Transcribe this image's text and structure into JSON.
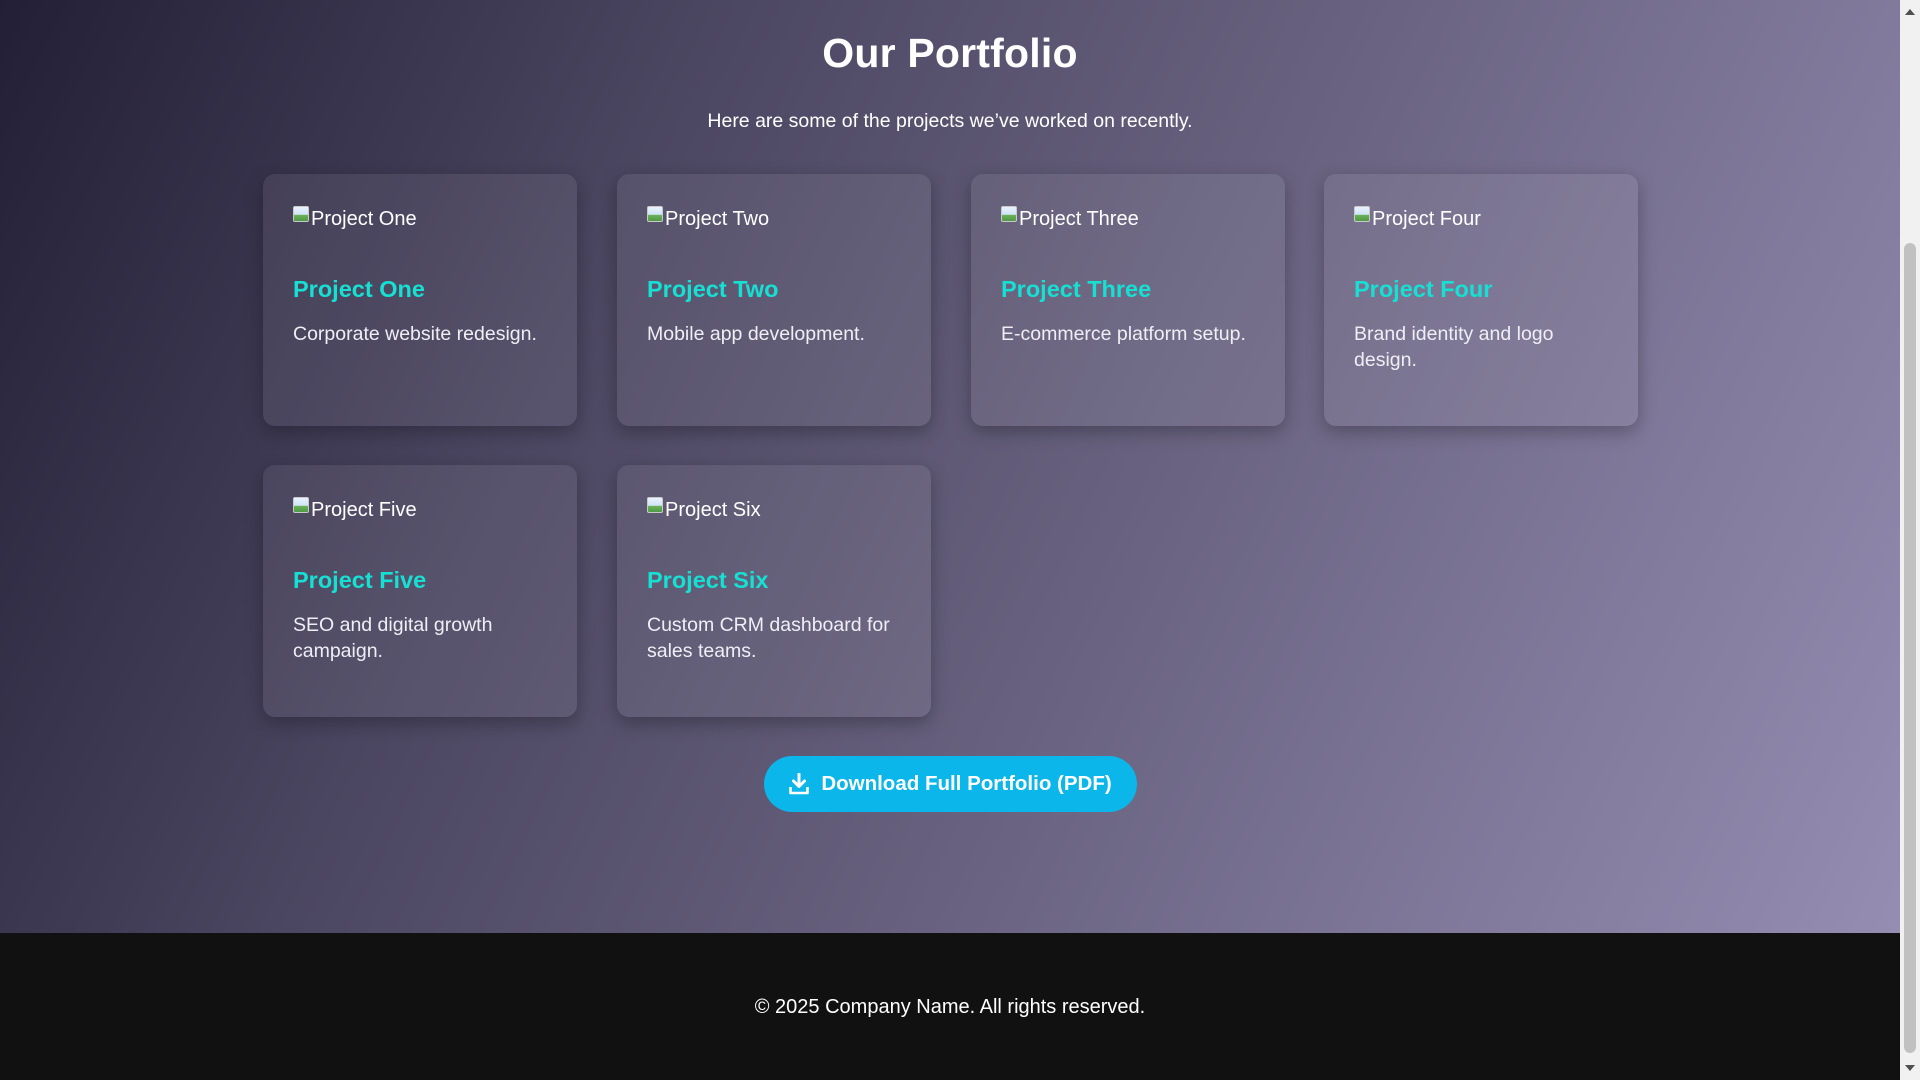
{
  "portfolio": {
    "title": "Our Portfolio",
    "subtitle": "Here are some of the projects we’ve worked on recently.",
    "projects": [
      {
        "image_alt": "Project One",
        "title": "Project One",
        "description": "Corporate website redesign."
      },
      {
        "image_alt": "Project Two",
        "title": "Project Two",
        "description": "Mobile app development."
      },
      {
        "image_alt": "Project Three",
        "title": "Project Three",
        "description": "E-commerce platform setup."
      },
      {
        "image_alt": "Project Four",
        "title": "Project Four",
        "description": "Brand identity and logo design."
      },
      {
        "image_alt": "Project Five",
        "title": "Project Five",
        "description": "SEO and digital growth campaign."
      },
      {
        "image_alt": "Project Six",
        "title": "Project Six",
        "description": "Custom CRM dashboard for sales teams."
      }
    ],
    "download_label": "Download Full Portfolio (PDF)",
    "download_icon": "download-icon"
  },
  "footer": {
    "text": "© 2025 Company Name. All rights reserved."
  },
  "colors": {
    "accent_title": "#16e0d4",
    "button_bg": "#0ab6ea",
    "footer_bg": "#111111"
  }
}
